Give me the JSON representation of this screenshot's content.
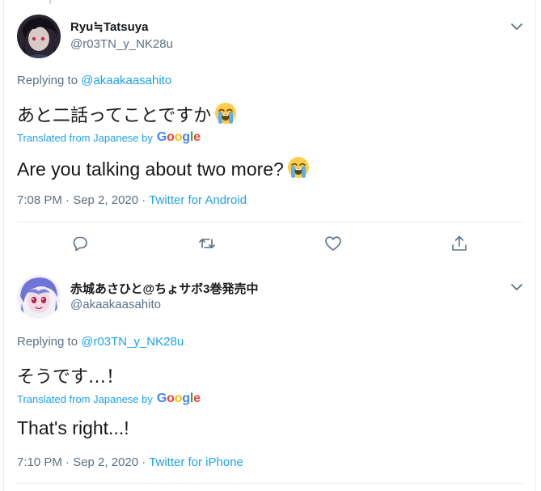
{
  "tweets": [
    {
      "display_name": "Ryu≒Tatsuya",
      "handle": "@r03TN_y_NK28u",
      "replying_prefix": "Replying to ",
      "replying_to": "@akaakaasahito",
      "original_text": "あと二話ってことですか",
      "translated_prefix": "Translated from Japanese by",
      "translated_text": "Are you talking about two more?",
      "time": "7:08 PM · Sep 2, 2020 · ",
      "source": "Twitter for Android",
      "emoji": "loudly-crying-face"
    },
    {
      "display_name": "赤城あさひと@ちょサボ3巻発売中",
      "handle": "@akaakaasahito",
      "replying_prefix": "Replying to ",
      "replying_to": "@r03TN_y_NK28u",
      "original_text": "そうです…！",
      "translated_prefix": "Translated from Japanese by",
      "translated_text": "That's right...!",
      "time": "7:10 PM · Sep 2, 2020 · ",
      "source": "Twitter for iPhone"
    }
  ],
  "google_logo": [
    "G",
    "o",
    "o",
    "g",
    "l",
    "e"
  ],
  "actions": [
    "reply-icon",
    "retweet-icon",
    "like-icon",
    "share-icon"
  ],
  "colors": {
    "link": "#1da1f2",
    "secondary_text": "#5b7083",
    "primary_text": "#14171a",
    "border": "#e6ecf0"
  }
}
